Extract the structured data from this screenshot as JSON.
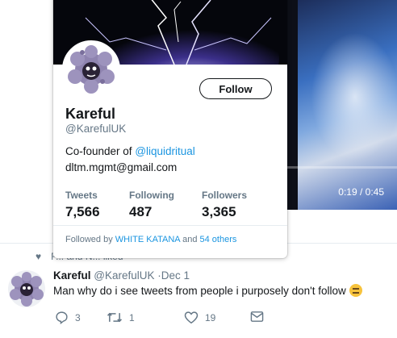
{
  "video": {
    "time": "0:19 / 0:45"
  },
  "liked_row": {
    "text": "F... and N... liked"
  },
  "tweet": {
    "name": "Kareful",
    "handle": "@KarefulUK",
    "separator": "·",
    "date": "Dec 1",
    "text": "Man why do i see tweets from people i purposely don't follow",
    "emoji": "thinking-face-emoji",
    "reply_count": "3",
    "retweet_count": "1",
    "like_count": "19"
  },
  "card": {
    "follow_label": "Follow",
    "name": "Kareful",
    "handle": "@KarefulUK",
    "bio_prefix": "Co-founder of ",
    "bio_link": "@liquidritual",
    "email": "dltm.mgmt@gmail.com",
    "stats": [
      {
        "label": "Tweets",
        "value": "7,566"
      },
      {
        "label": "Following",
        "value": "487"
      },
      {
        "label": "Followers",
        "value": "3,365"
      }
    ],
    "followed_prefix": "Followed by ",
    "followed_user": "WHITE KATANA",
    "followed_and": " and ",
    "followed_others": "54 others"
  },
  "colors": {
    "link": "#1b95e0",
    "muted": "#657786",
    "text": "#14171a"
  }
}
